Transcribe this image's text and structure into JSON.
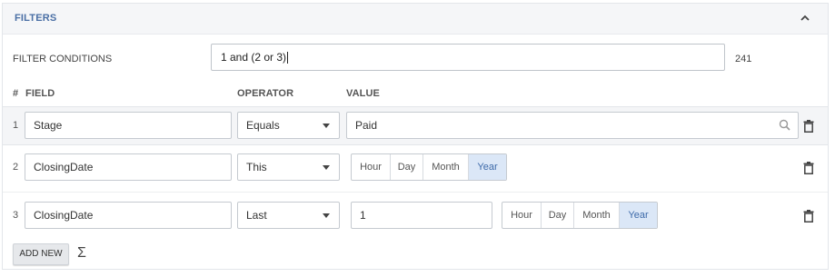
{
  "header": {
    "title": "FILTERS",
    "collapse_icon": "chevron-up-icon"
  },
  "filter_conditions": {
    "label": "FILTER CONDITIONS",
    "value": "1 and (2 or 3)",
    "count": "241"
  },
  "columns": {
    "num": "#",
    "field": "FIELD",
    "operator": "OPERATOR",
    "value": "VALUE"
  },
  "rows": [
    {
      "num": "1",
      "field": "Stage",
      "operator": "Equals",
      "value": "Paid"
    },
    {
      "num": "2",
      "field": "ClosingDate",
      "operator": "This",
      "units": [
        "Hour",
        "Day",
        "Month",
        "Year"
      ],
      "selected_unit": "Year"
    },
    {
      "num": "3",
      "field": "ClosingDate",
      "operator": "Last",
      "value": "1",
      "units": [
        "Hour",
        "Day",
        "Month",
        "Year"
      ],
      "selected_unit": "Year"
    }
  ],
  "footer": {
    "add_new_label": "ADD NEW",
    "sum_icon": "sigma-icon"
  },
  "colors": {
    "accent": "#4a6fa5",
    "selected_bg": "#dbe7f7",
    "header_bg": "#f5f6f8"
  }
}
